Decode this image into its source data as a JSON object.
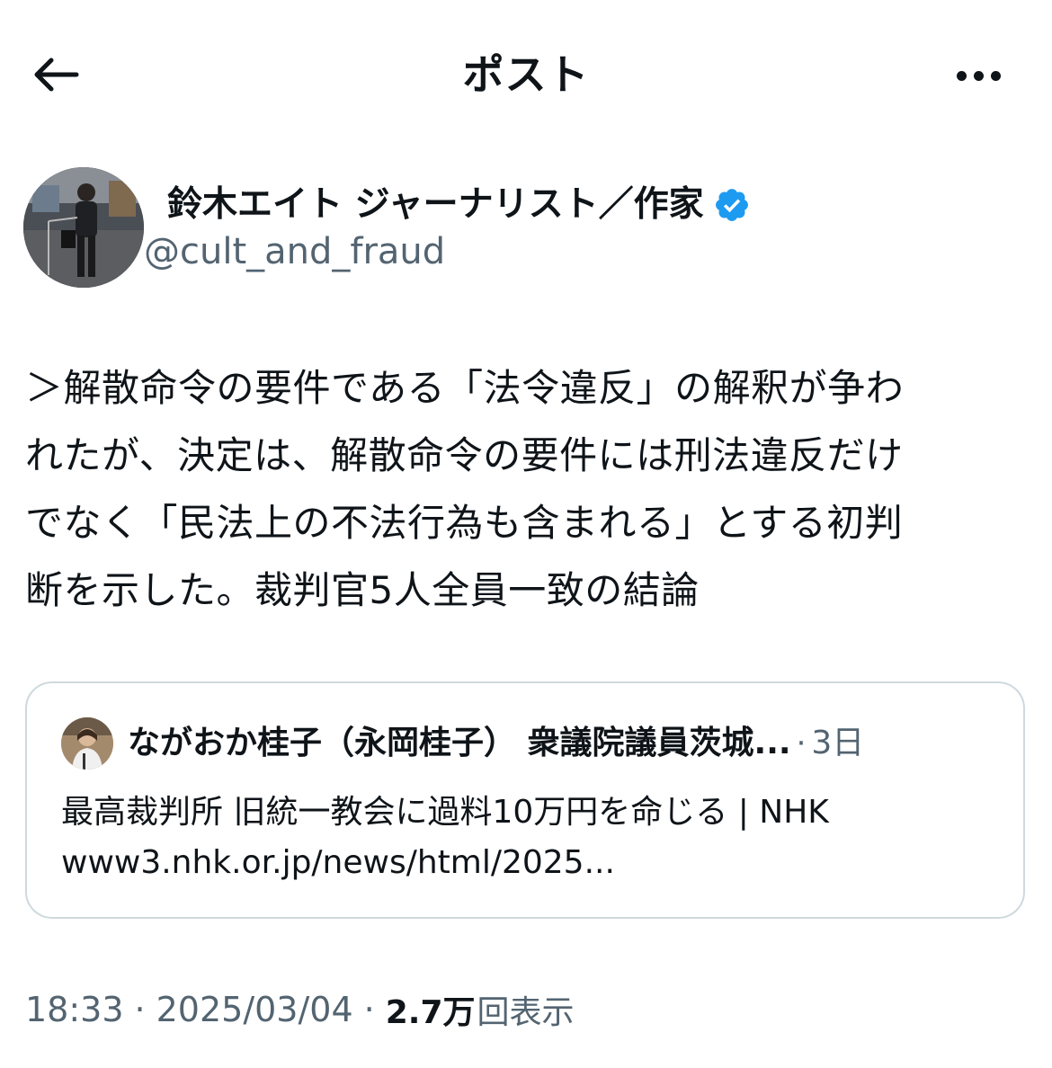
{
  "header": {
    "title": "ポスト",
    "back_icon": "arrow-left-icon",
    "more_icon": "more-horizontal-icon"
  },
  "author": {
    "display_name": "鈴木エイト ジャーナリスト／作家",
    "handle": "@cult_and_fraud",
    "verified": true,
    "verified_color": "#1d9bf0"
  },
  "tweet": {
    "lines": [
      "＞解散命令の要件である「法令違反」の解釈が争わ",
      "れたが、決定は、解散命令の要件には刑法違反だけ",
      "でなく「民法上の不法行為も含まれる」とする初判",
      "断を示した。裁判官5人全員一致の結論"
    ]
  },
  "quote": {
    "name": "ながおか桂子（永岡桂子） 衆議院議員茨城...",
    "separator": "·",
    "time": "3日",
    "text": "最高裁判所 旧統一教会に過料10万円を命じる | NHK",
    "link": "www3.nhk.or.jp/news/html/2025..."
  },
  "meta": {
    "time": "18:33",
    "separator": "·",
    "date": "2025/03/04",
    "views_count": "2.7万",
    "views_label": "回表示"
  },
  "colors": {
    "text": "#0f1419",
    "secondary": "#536471",
    "border": "#cfd9de",
    "accent": "#1d9bf0"
  }
}
